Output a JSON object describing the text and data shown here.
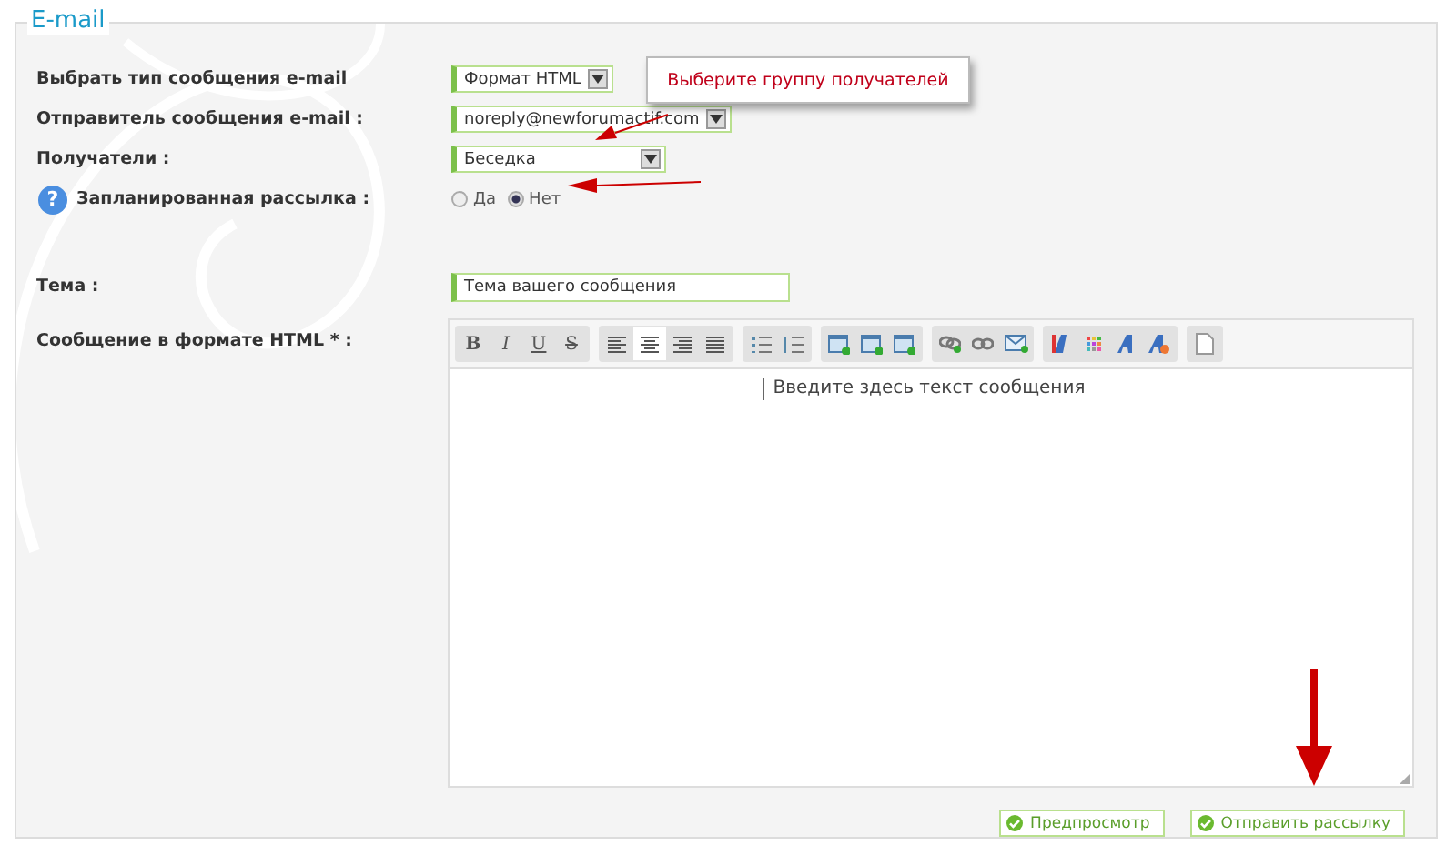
{
  "section": {
    "legend": "E-mail"
  },
  "fields": [
    {
      "label": "Выбрать тип сообщения e-mail",
      "kind": "select",
      "value": "Формат HTML"
    },
    {
      "label": "Отправитель сообщения e-mail :",
      "kind": "select",
      "value": "noreply@newforumactif.com"
    },
    {
      "label": "Получатели :",
      "kind": "select",
      "value": "Беседка"
    },
    {
      "label": "Запланированная рассылка :",
      "kind": "radio",
      "help": "?",
      "options": [
        {
          "label": "Да",
          "selected": false
        },
        {
          "label": "Нет",
          "selected": true
        }
      ]
    },
    {
      "label": "Тема :",
      "kind": "text",
      "value": "Тема вашего сообщения"
    },
    {
      "label": "Сообщение в формате HTML * :",
      "kind": "editor",
      "format_buttons": [
        "B",
        "I",
        "U",
        "S"
      ],
      "align": [
        {
          "selected": false
        },
        {
          "selected": true
        },
        {
          "selected": false
        },
        {
          "selected": false
        }
      ],
      "value": "Введите здесь текст сообщения"
    }
  ],
  "callout": "Выберите группу получателей",
  "buttons": [
    "Предпросмотр",
    "Отправить рассылку"
  ]
}
